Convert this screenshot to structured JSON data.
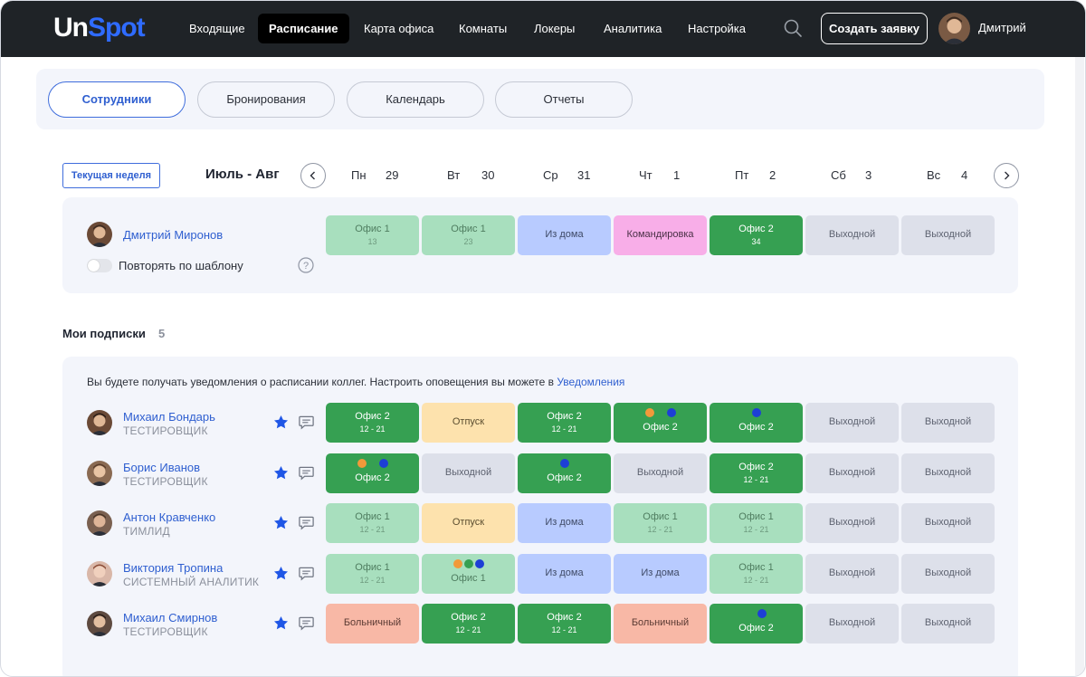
{
  "app": {
    "logo_a": "Un",
    "logo_b": "Spot"
  },
  "nav": {
    "items": [
      "Входящие",
      "Расписание",
      "Карта офиса",
      "Комнаты",
      "Локеры",
      "Аналитика",
      "Настройка"
    ],
    "active": "Расписание",
    "create_label": "Создать заявку",
    "user_name": "Дмитрий"
  },
  "tabs": [
    "Сотрудники",
    "Бронирования",
    "Календарь",
    "Отчеты"
  ],
  "week": {
    "current_week_label": "Текущая неделя",
    "month_label": "Июль - Авг",
    "days": [
      {
        "name": "Пн",
        "date": "29"
      },
      {
        "name": "Вт",
        "date": "30"
      },
      {
        "name": "Ср",
        "date": "31"
      },
      {
        "name": "Чт",
        "date": "1"
      },
      {
        "name": "Пт",
        "date": "2"
      },
      {
        "name": "Сб",
        "date": "3"
      },
      {
        "name": "Вс",
        "date": "4"
      }
    ]
  },
  "me": {
    "name": "Дмитрий Миронов",
    "repeat_label": "Повторять по шаблону",
    "cells": [
      {
        "type": "off1",
        "title": "Офис 1",
        "sub": "13"
      },
      {
        "type": "off1",
        "title": "Офис 1",
        "sub": "23"
      },
      {
        "type": "home",
        "title": "Из дома",
        "sub": ""
      },
      {
        "type": "trip",
        "title": "Командировка",
        "sub": ""
      },
      {
        "type": "off2",
        "title": "Офис 2",
        "sub": "34"
      },
      {
        "type": "wkend",
        "title": "Выходной",
        "sub": ""
      },
      {
        "type": "wkend",
        "title": "Выходной",
        "sub": ""
      }
    ]
  },
  "subscriptions": {
    "title": "Мои подписки",
    "count": "5",
    "notice_text": "Вы будете получать уведомления о расписании коллег. Настроить оповещения вы можете в",
    "notice_link": "Уведомления",
    "people": [
      {
        "name": "Михаил Бондарь",
        "role": "ТЕСТИРОВЩИК",
        "cells": [
          {
            "type": "off2",
            "title": "Офис 2",
            "sub": "12 - 21"
          },
          {
            "type": "vac",
            "title": "Отпуск",
            "sub": ""
          },
          {
            "type": "off2",
            "title": "Офис 2",
            "sub": "12 - 21"
          },
          {
            "type": "off2",
            "title": "Офис 2",
            "sub": "",
            "dots": [
              "#f2993a",
              "#36a052",
              "#1d3fd6"
            ]
          },
          {
            "type": "off2",
            "title": "Офис 2",
            "sub": "",
            "dots": [
              "#1d3fd6"
            ]
          },
          {
            "type": "wkend",
            "title": "Выходной",
            "sub": ""
          },
          {
            "type": "wkend",
            "title": "Выходной",
            "sub": ""
          }
        ]
      },
      {
        "name": "Борис Иванов",
        "role": "ТЕСТИРОВЩИК",
        "cells": [
          {
            "type": "off2",
            "title": "Офис 2",
            "sub": "",
            "dots": [
              "#f2993a",
              "#36a052",
              "#1d3fd6"
            ]
          },
          {
            "type": "wkend",
            "title": "Выходной",
            "sub": ""
          },
          {
            "type": "off2",
            "title": "Офис 2",
            "sub": "",
            "dots": [
              "#1d3fd6"
            ]
          },
          {
            "type": "wkend",
            "title": "Выходной",
            "sub": ""
          },
          {
            "type": "off2",
            "title": "Офис 2",
            "sub": "12 - 21"
          },
          {
            "type": "wkend",
            "title": "Выходной",
            "sub": ""
          },
          {
            "type": "wkend",
            "title": "Выходной",
            "sub": ""
          }
        ]
      },
      {
        "name": "Антон Кравченко",
        "role": "ТИМЛИД",
        "cells": [
          {
            "type": "off1",
            "title": "Офис 1",
            "sub": "12 - 21"
          },
          {
            "type": "vac",
            "title": "Отпуск",
            "sub": ""
          },
          {
            "type": "home",
            "title": "Из дома",
            "sub": ""
          },
          {
            "type": "off1",
            "title": "Офис 1",
            "sub": "12 - 21"
          },
          {
            "type": "off1",
            "title": "Офис 1",
            "sub": "12 - 21"
          },
          {
            "type": "wkend",
            "title": "Выходной",
            "sub": ""
          },
          {
            "type": "wkend",
            "title": "Выходной",
            "sub": ""
          }
        ]
      },
      {
        "name": "Виктория Тропина",
        "role": "СИСТЕМНЫЙ АНАЛИТИК",
        "cells": [
          {
            "type": "off1",
            "title": "Офис 1",
            "sub": "12 - 21"
          },
          {
            "type": "off1",
            "title": "Офис 1",
            "sub": "",
            "dots": [
              "#f2993a",
              "#36a052",
              "#1d3fd6"
            ]
          },
          {
            "type": "home",
            "title": "Из дома",
            "sub": ""
          },
          {
            "type": "home",
            "title": "Из дома",
            "sub": ""
          },
          {
            "type": "off1",
            "title": "Офис 1",
            "sub": "12 - 21"
          },
          {
            "type": "wkend",
            "title": "Выходной",
            "sub": ""
          },
          {
            "type": "wkend",
            "title": "Выходной",
            "sub": ""
          }
        ]
      },
      {
        "name": "Михаил Смирнов",
        "role": "ТЕСТИРОВЩИК",
        "cells": [
          {
            "type": "sick",
            "title": "Больничный",
            "sub": ""
          },
          {
            "type": "off2",
            "title": "Офис 2",
            "sub": "12 - 21"
          },
          {
            "type": "off2",
            "title": "Офис 2",
            "sub": "12 - 21"
          },
          {
            "type": "sick",
            "title": "Больничный",
            "sub": ""
          },
          {
            "type": "off2",
            "title": "Офис 2",
            "sub": "",
            "dots": [
              "#36a052",
              "#1d3fd6"
            ]
          },
          {
            "type": "wkend",
            "title": "Выходной",
            "sub": ""
          },
          {
            "type": "wkend",
            "title": "Выходной",
            "sub": ""
          }
        ]
      }
    ]
  },
  "colors": {
    "accent": "#2f5fd0",
    "office2": "#36a052",
    "office1": "#a8dfbe",
    "home": "#b8cbff",
    "trip": "#f8aee8",
    "weekend": "#dde0ea",
    "vacation": "#fde2ad",
    "sick": "#f8b8a6"
  }
}
